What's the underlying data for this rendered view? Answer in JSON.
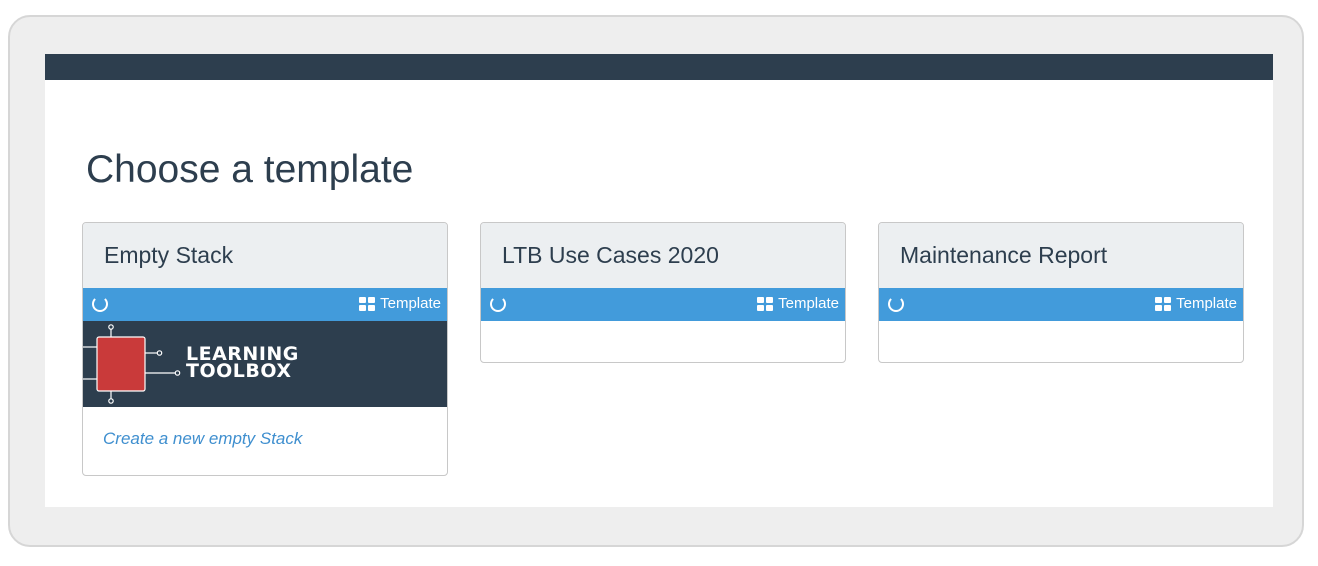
{
  "page": {
    "title": "Choose a template"
  },
  "templates": [
    {
      "title": "Empty Stack",
      "badge": "Template",
      "logo_line1": "LEARNING",
      "logo_line2": "TOOLBOX",
      "link": "Create a new empty Stack"
    },
    {
      "title": "LTB Use Cases 2020",
      "badge": "Template"
    },
    {
      "title": "Maintenance Report",
      "badge": "Template"
    }
  ],
  "colors": {
    "topbar": "#2d3e4e",
    "card_bar": "#429bdb",
    "link": "#3f8fcf",
    "logo_square": "#c93a3a"
  }
}
